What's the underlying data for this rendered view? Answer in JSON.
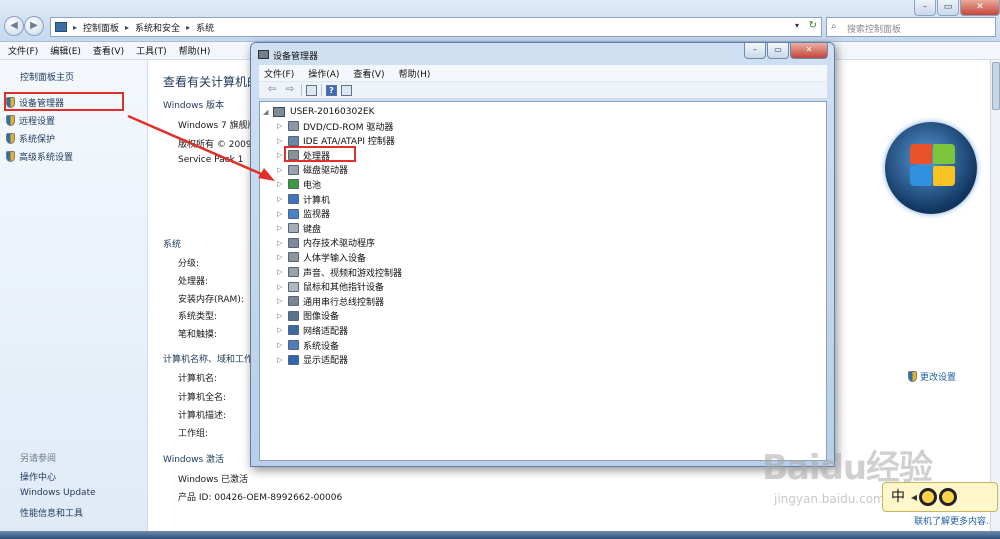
{
  "control_panel": {
    "breadcrumb": [
      "控制面板",
      "系统和安全",
      "系统"
    ],
    "search_placeholder": "搜索控制面板",
    "menu": [
      "文件(F)",
      "编辑(E)",
      "查看(V)",
      "工具(T)",
      "帮助(H)"
    ],
    "left_home": "控制面板主页",
    "left_links": [
      "设备管理器",
      "远程设置",
      "系统保护",
      "高级系统设置"
    ],
    "see_also_label": "另请参阅",
    "see_also_links": [
      "操作中心",
      "Windows Update",
      "性能信息和工具"
    ],
    "main_title": "查看有关计算机的",
    "edition_head": "Windows 版本",
    "edition_rows": [
      "Windows 7 旗舰版",
      "版权所有 © 2009",
      "Service Pack 1"
    ],
    "system_head": "系统",
    "system_rows": [
      "分级:",
      "处理器:",
      "安装内存(RAM):",
      "系统类型:",
      "笔和触摸:"
    ],
    "computer_head": "计算机名称、域和工作",
    "computer_rows": [
      "计算机名:",
      "计算机全名:",
      "计算机描述:",
      "工作组:"
    ],
    "activation_head": "Windows 激活",
    "activation_status": "Windows 已激活",
    "product_id": "产品 ID: 00426-OEM-8992662-00006",
    "change_settings": "更改设置",
    "bottom_link": "联机了解更多内容..."
  },
  "device_manager": {
    "title": "设备管理器",
    "menu": [
      "文件(F)",
      "操作(A)",
      "查看(V)",
      "帮助(H)"
    ],
    "root": "USER-20160302EK",
    "categories": [
      {
        "label": "DVD/CD-ROM 驱动器",
        "icon": "dvd-drive-icon",
        "color": "#8d97a3"
      },
      {
        "label": "IDE ATA/ATAPI 控制器",
        "icon": "ide-controller-icon",
        "color": "#6a86a8"
      },
      {
        "label": "处理器",
        "icon": "processor-icon",
        "color": "#8c9195"
      },
      {
        "label": "磁盘驱动器",
        "icon": "disk-drive-icon",
        "color": "#9aa2ab"
      },
      {
        "label": "电池",
        "icon": "battery-icon",
        "color": "#3c9c3c"
      },
      {
        "label": "计算机",
        "icon": "computer-icon",
        "color": "#3c74c0"
      },
      {
        "label": "监视器",
        "icon": "monitor-icon",
        "color": "#4a82c8"
      },
      {
        "label": "键盘",
        "icon": "keyboard-icon",
        "color": "#a5adb6"
      },
      {
        "label": "内存技术驱动程序",
        "icon": "memory-icon",
        "color": "#7e8a98"
      },
      {
        "label": "人体学输入设备",
        "icon": "hid-icon",
        "color": "#8f959c"
      },
      {
        "label": "声音、视频和游戏控制器",
        "icon": "sound-icon",
        "color": "#9aa0a6"
      },
      {
        "label": "鼠标和其他指针设备",
        "icon": "mouse-icon",
        "color": "#b0b6bd"
      },
      {
        "label": "通用串行总线控制器",
        "icon": "usb-icon",
        "color": "#7d8690"
      },
      {
        "label": "图像设备",
        "icon": "camera-icon",
        "color": "#58728f"
      },
      {
        "label": "网络适配器",
        "icon": "network-adapter-icon",
        "color": "#3b6ba5"
      },
      {
        "label": "系统设备",
        "icon": "system-device-icon",
        "color": "#4b7dbf"
      },
      {
        "label": "显示适配器",
        "icon": "display-adapter-icon",
        "color": "#2f67ad"
      }
    ]
  },
  "watermark": {
    "logo": "Baidu经验",
    "sub": "jingyan.baidu.com",
    "ime_char": "中"
  },
  "colors": {
    "highlight_red": "#e0302a",
    "link_blue": "#1e5fa8",
    "title_blue": "#1e395b"
  }
}
